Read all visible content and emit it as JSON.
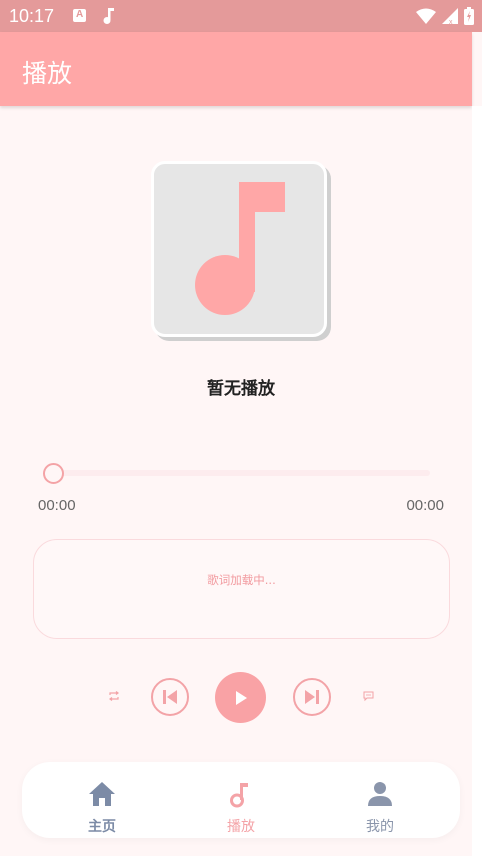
{
  "status_bar": {
    "time": "10:17",
    "icons": [
      "text-a-icon",
      "music-note-icon",
      "wifi-icon",
      "signal-icon",
      "battery-icon"
    ]
  },
  "app_bar": {
    "title": "播放"
  },
  "player": {
    "album_icon": "music-note-icon",
    "song_title": "暂无播放",
    "progress": 0,
    "current_time": "00:00",
    "total_time": "00:00",
    "lyrics_placeholder": "歌词加载中...",
    "controls": [
      "repeat-icon",
      "previous-icon",
      "play-icon",
      "next-icon",
      "lyrics-icon"
    ]
  },
  "bottom_nav": {
    "items": [
      {
        "label": "主页",
        "icon": "home-icon"
      },
      {
        "label": "播放",
        "icon": "music-note-icon",
        "active": true
      },
      {
        "label": "我的",
        "icon": "person-icon"
      }
    ]
  },
  "colors": {
    "accent": "#ffa7a7",
    "status_bar": "#e49a9a",
    "background": "#fff6f6",
    "nav_inactive": "#7c8ba6"
  }
}
